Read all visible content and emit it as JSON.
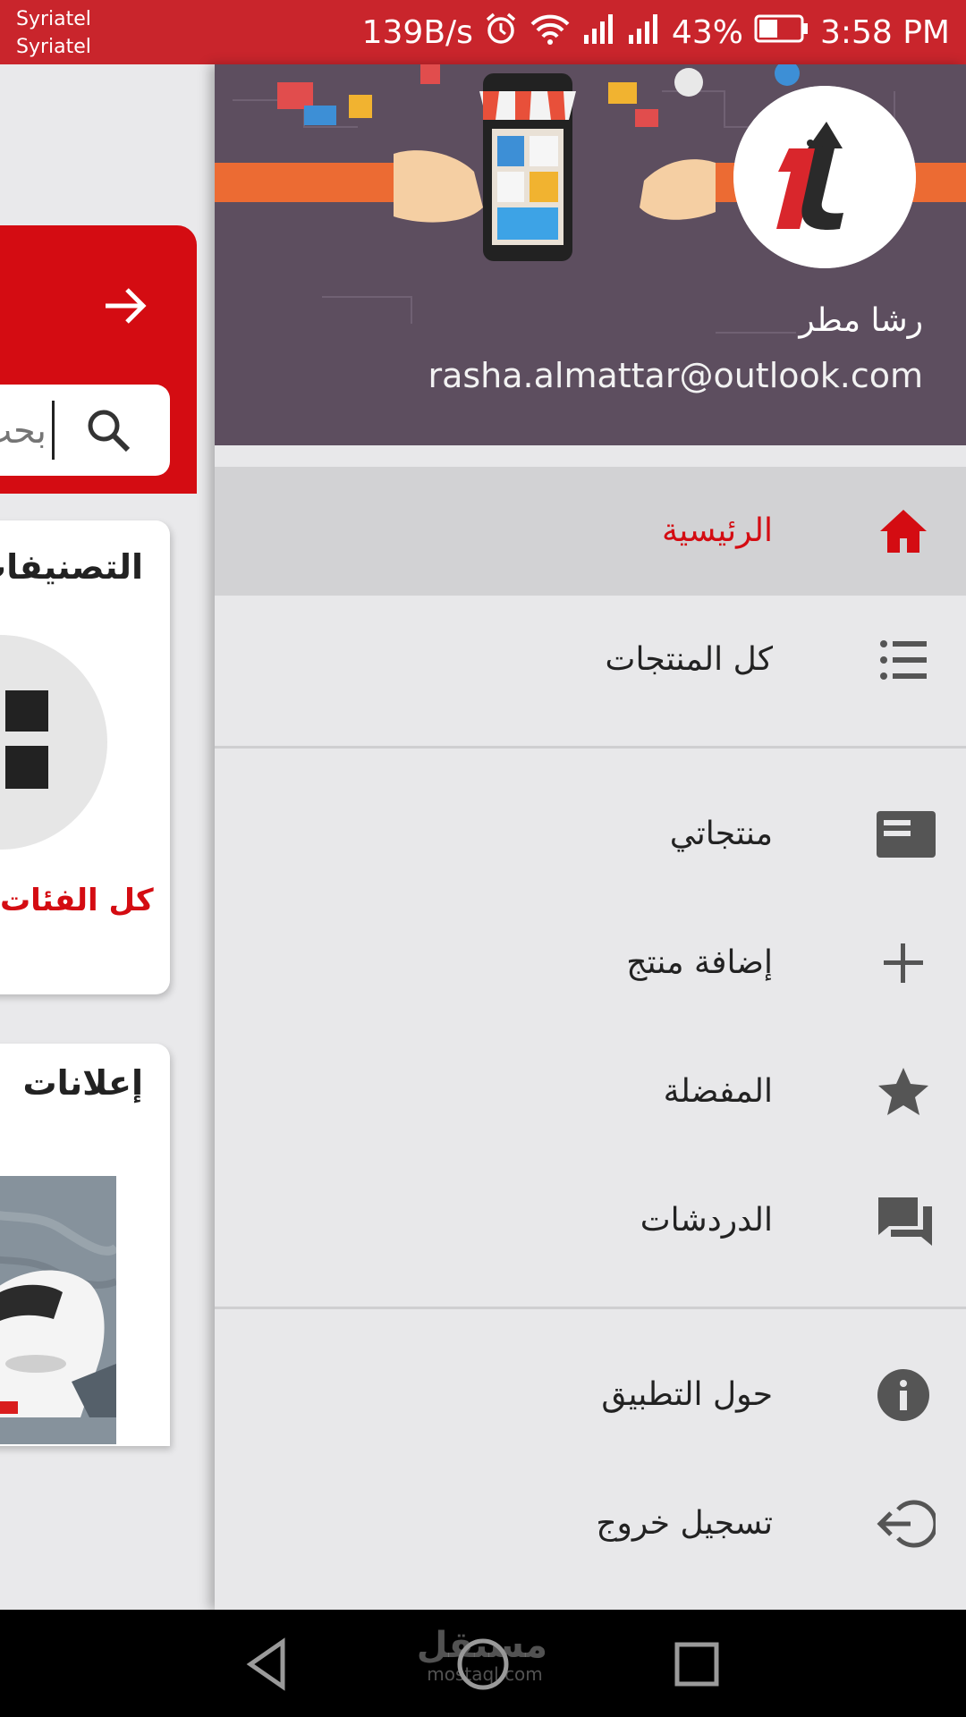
{
  "status_bar": {
    "carrier_1": "Syriatel",
    "carrier_2": "Syriatel",
    "net_speed": "139B/s",
    "battery": "43%",
    "time": "3:58 PM",
    "icons": [
      "alarm-icon",
      "wifi-icon",
      "signal-icon",
      "signal-icon",
      "battery-icon"
    ],
    "color": "#c9252c"
  },
  "background_page": {
    "search_placeholder": "بحث",
    "categories_title": "التصنيفات",
    "all_categories": "كل الفئات",
    "ads_title": "إعلانات",
    "accent": "#d40c12"
  },
  "drawer": {
    "user": {
      "name": "رشا مطر",
      "email": "rasha.almattar@outlook.com"
    },
    "menu": [
      {
        "label": "الرئيسية",
        "icon": "home-icon",
        "active": true
      },
      {
        "label": "كل المنتجات",
        "icon": "list-icon"
      },
      {
        "label": "منتجاتي",
        "icon": "my-products-icon"
      },
      {
        "label": "إضافة منتج",
        "icon": "plus-icon"
      },
      {
        "label": "المفضلة",
        "icon": "star-icon"
      },
      {
        "label": "الدردشات",
        "icon": "chat-icon"
      },
      {
        "label": "حول التطبيق",
        "icon": "info-icon"
      },
      {
        "label": "تسجيل خروج",
        "icon": "logout-icon"
      }
    ]
  },
  "nav_bar": {
    "icons": [
      "back-icon",
      "home-circle-icon",
      "recents-icon"
    ],
    "watermark_ar": "مستقل",
    "watermark_en": "mostaql.com"
  }
}
